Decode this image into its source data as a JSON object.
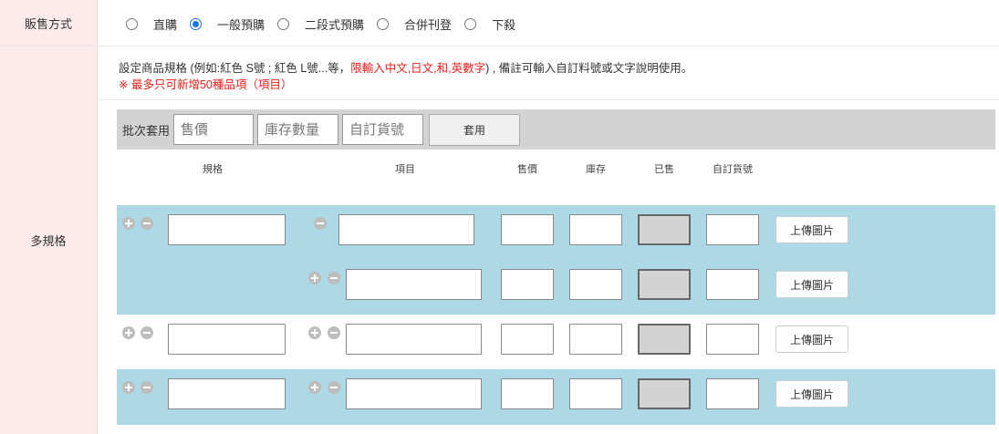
{
  "sale_method": {
    "label": "販售方式",
    "options": [
      {
        "label": "直購",
        "checked": false
      },
      {
        "label": "一般預購",
        "checked": true
      },
      {
        "label": "二段式預購",
        "checked": false
      },
      {
        "label": "合併刊登",
        "checked": false
      },
      {
        "label": "下殺",
        "checked": false
      }
    ]
  },
  "multi_spec": {
    "label": "多規格",
    "desc_part1": "設定商品規格 (例如:紅色 S號 ; 紅色 L號...等，",
    "desc_red": "限輸入中文,日文,和,英數字",
    "desc_part2": ") , 備註可輸入自訂料號或文字說明使用。",
    "limit_note": "※ 最多只可新增50種品項（項目）",
    "batch": {
      "label": "批次套用",
      "price_placeholder": "售價",
      "stock_placeholder": "庫存數量",
      "sku_placeholder": "自訂貨號",
      "apply_button": "套用"
    },
    "columns": {
      "spec": "規格",
      "item": "項目",
      "price": "售價",
      "stock": "庫存",
      "sold": "已售",
      "sku": "自訂貨號"
    },
    "upload_label": "上傳圖片"
  },
  "colors": {
    "label_bg": "#fdeaea",
    "band_bg": "#add8e6",
    "batch_bg": "#d3d3d3",
    "accent": "#1a73e8",
    "warning": "#e0201b"
  }
}
